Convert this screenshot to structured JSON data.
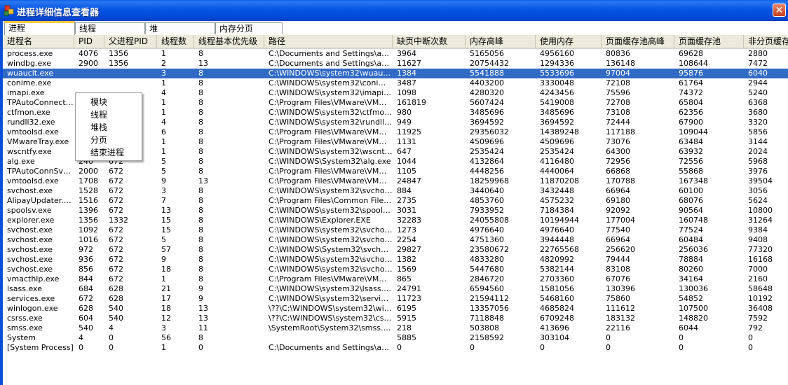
{
  "window": {
    "title": "进程详细信息查看器",
    "close_glyph": "✕"
  },
  "tabs": [
    {
      "label": "进程",
      "active": true
    },
    {
      "label": "线程",
      "active": false
    },
    {
      "label": "堆",
      "active": false
    },
    {
      "label": "内存分页",
      "active": false
    }
  ],
  "table": {
    "columns": [
      "进程名",
      "PID",
      "父进程PID",
      "线程数",
      "线程基本优先级",
      "路径",
      "缺页中断次数",
      "内存高峰",
      "使用内存",
      "页面缓存池高峰",
      "页面缓存池",
      "非分页缓存"
    ],
    "selected_row": 2,
    "rows": [
      [
        "process.exe",
        "4076",
        "1356",
        "1",
        "8",
        "C:\\Documents and Settings\\angel...",
        "3964",
        "5165056",
        "4956160",
        "80836",
        "69628",
        "2880"
      ],
      [
        "windbg.exe",
        "2900",
        "1356",
        "2",
        "13",
        "C:\\Documents and Settings\\angel...",
        "11627",
        "20754432",
        "1294336",
        "136148",
        "108644",
        "7472"
      ],
      [
        "wuauclt.exe",
        "",
        "",
        "3",
        "8",
        "C:\\WINDOWS\\system32\\wuauclt....",
        "1384",
        "5541888",
        "5533696",
        "97004",
        "95876",
        "6040"
      ],
      [
        "conime.exe",
        "",
        "",
        "1",
        "8",
        "C:\\WINDOWS\\system32\\conime....",
        "3487",
        "4403200",
        "3330048",
        "72108",
        "61764",
        "2944"
      ],
      [
        "imapi.exe",
        "",
        "",
        "4",
        "8",
        "C:\\WINDOWS\\system32\\imapi.exe",
        "1098",
        "4280320",
        "4243456",
        "75596",
        "74372",
        "5240"
      ],
      [
        "TPAutoConnect....",
        "",
        "",
        "1",
        "8",
        "C:\\Program Files\\VMware\\VMwar...",
        "161819",
        "5607424",
        "5419008",
        "72708",
        "65804",
        "6368"
      ],
      [
        "ctfmon.exe",
        "",
        "",
        "1",
        "8",
        "C:\\WINDOWS\\system32\\ctfmon....",
        "980",
        "3485696",
        "3485696",
        "73108",
        "62356",
        "3680"
      ],
      [
        "rundll32.exe",
        "",
        "",
        "4",
        "8",
        "C:\\WINDOWS\\system32\\rundll32...",
        "949",
        "3694592",
        "3694592",
        "72444",
        "67900",
        "3320"
      ],
      [
        "vmtoolsd.exe",
        "",
        "",
        "6",
        "8",
        "C:\\Program Files\\VMware\\VMwar...",
        "11925",
        "29356032",
        "14389248",
        "117188",
        "109044",
        "5856"
      ],
      [
        "VMwareTray.exe",
        "128",
        "1356",
        "1",
        "8",
        "C:\\Program Files\\VMware\\VMwar...",
        "1131",
        "4509696",
        "4509696",
        "73076",
        "63484",
        "3144"
      ],
      [
        "wscntfy.exe",
        "508",
        "972",
        "1",
        "8",
        "C:\\WINDOWS\\system32\\wscntfy....",
        "647",
        "2535424",
        "2535424",
        "64300",
        "63932",
        "2024"
      ],
      [
        "alg.exe",
        "240",
        "672",
        "5",
        "8",
        "C:\\WINDOWS\\System32\\alg.exe",
        "1044",
        "4132864",
        "4116480",
        "72956",
        "72556",
        "5968"
      ],
      [
        "TPAutoConnSvc....",
        "2000",
        "672",
        "5",
        "8",
        "C:\\Program Files\\VMware\\VMwar...",
        "1105",
        "4448256",
        "4440064",
        "66868",
        "55868",
        "3976"
      ],
      [
        "vmtoolsd.exe",
        "1708",
        "672",
        "9",
        "13",
        "C:\\Program Files\\VMware\\VMwar...",
        "24847",
        "18259968",
        "11870208",
        "170788",
        "167348",
        "39504"
      ],
      [
        "svchost.exe",
        "1528",
        "672",
        "3",
        "8",
        "C:\\WINDOWS\\system32\\svchost....",
        "884",
        "3440640",
        "3432448",
        "66964",
        "60100",
        "3056"
      ],
      [
        "AlipayUpdater.exe",
        "1516",
        "672",
        "7",
        "8",
        "C:\\Program Files\\Common Files\\ali...",
        "2735",
        "4853760",
        "4575232",
        "69180",
        "68076",
        "5624"
      ],
      [
        "spoolsv.exe",
        "1396",
        "672",
        "13",
        "8",
        "C:\\WINDOWS\\system32\\spoolsv....",
        "3031",
        "7933952",
        "7184384",
        "92092",
        "90564",
        "10800"
      ],
      [
        "explorer.exe",
        "1356",
        "1332",
        "15",
        "8",
        "C:\\WINDOWS\\Explorer.EXE",
        "32283",
        "24055808",
        "10194944",
        "177004",
        "160748",
        "31264"
      ],
      [
        "svchost.exe",
        "1092",
        "672",
        "15",
        "8",
        "C:\\WINDOWS\\system32\\svchost....",
        "1273",
        "4976640",
        "4976640",
        "77540",
        "77524",
        "9384"
      ],
      [
        "svchost.exe",
        "1016",
        "672",
        "5",
        "8",
        "C:\\WINDOWS\\system32\\svchost....",
        "2254",
        "4751360",
        "3944448",
        "66964",
        "60484",
        "9408"
      ],
      [
        "svchost.exe",
        "972",
        "672",
        "57",
        "8",
        "C:\\WINDOWS\\System32\\svchost....",
        "29827",
        "23580672",
        "22765568",
        "256620",
        "256036",
        "77320"
      ],
      [
        "svchost.exe",
        "936",
        "672",
        "9",
        "8",
        "C:\\WINDOWS\\system32\\svchost....",
        "1382",
        "4833280",
        "4820992",
        "79444",
        "78884",
        "16168"
      ],
      [
        "svchost.exe",
        "856",
        "672",
        "18",
        "8",
        "C:\\WINDOWS\\system32\\svchost....",
        "1569",
        "5447680",
        "5382144",
        "83108",
        "80260",
        "7000"
      ],
      [
        "vmacthlp.exe",
        "844",
        "672",
        "1",
        "8",
        "C:\\Program Files\\VMware\\VMwar...",
        "865",
        "2846720",
        "2703360",
        "67076",
        "34164",
        "2160"
      ],
      [
        "lsass.exe",
        "684",
        "628",
        "21",
        "9",
        "C:\\WINDOWS\\system32\\lsass.exe",
        "24791",
        "6594560",
        "1581056",
        "130396",
        "130036",
        "58648"
      ],
      [
        "services.exe",
        "672",
        "628",
        "17",
        "9",
        "C:\\WINDOWS\\system32\\services....",
        "11723",
        "21594112",
        "5468160",
        "75860",
        "54852",
        "10192"
      ],
      [
        "winlogon.exe",
        "628",
        "540",
        "18",
        "13",
        "\\??\\C:\\WINDOWS\\system32\\winl...",
        "6195",
        "13357056",
        "4685824",
        "111612",
        "107500",
        "36408"
      ],
      [
        "csrss.exe",
        "604",
        "540",
        "12",
        "13",
        "\\??\\C:\\WINDOWS\\system32\\csrs...",
        "5915",
        "7118848",
        "6709248",
        "183132",
        "148820",
        "7592"
      ],
      [
        "smss.exe",
        "540",
        "4",
        "3",
        "11",
        "\\SystemRoot\\System32\\smss.exe",
        "218",
        "503808",
        "413696",
        "22116",
        "6044",
        "792"
      ],
      [
        "System",
        "4",
        "0",
        "56",
        "8",
        "",
        "5885",
        "2158592",
        "303104",
        "0",
        "0",
        "0"
      ],
      [
        "[System Process]",
        "0",
        "0",
        "1",
        "0",
        "C:\\Documents and Settings\\angel...",
        "0",
        "0",
        "0",
        "0",
        "0",
        "0"
      ]
    ]
  },
  "context_menu": {
    "items": [
      "模块",
      "线程",
      "堆栈",
      "分页",
      "结束进程"
    ]
  },
  "colors": {
    "title_bar": "#0554e3",
    "selection": "#316ac5",
    "tab_highlight": "#ffc83c",
    "close_button": "#d4552c"
  }
}
